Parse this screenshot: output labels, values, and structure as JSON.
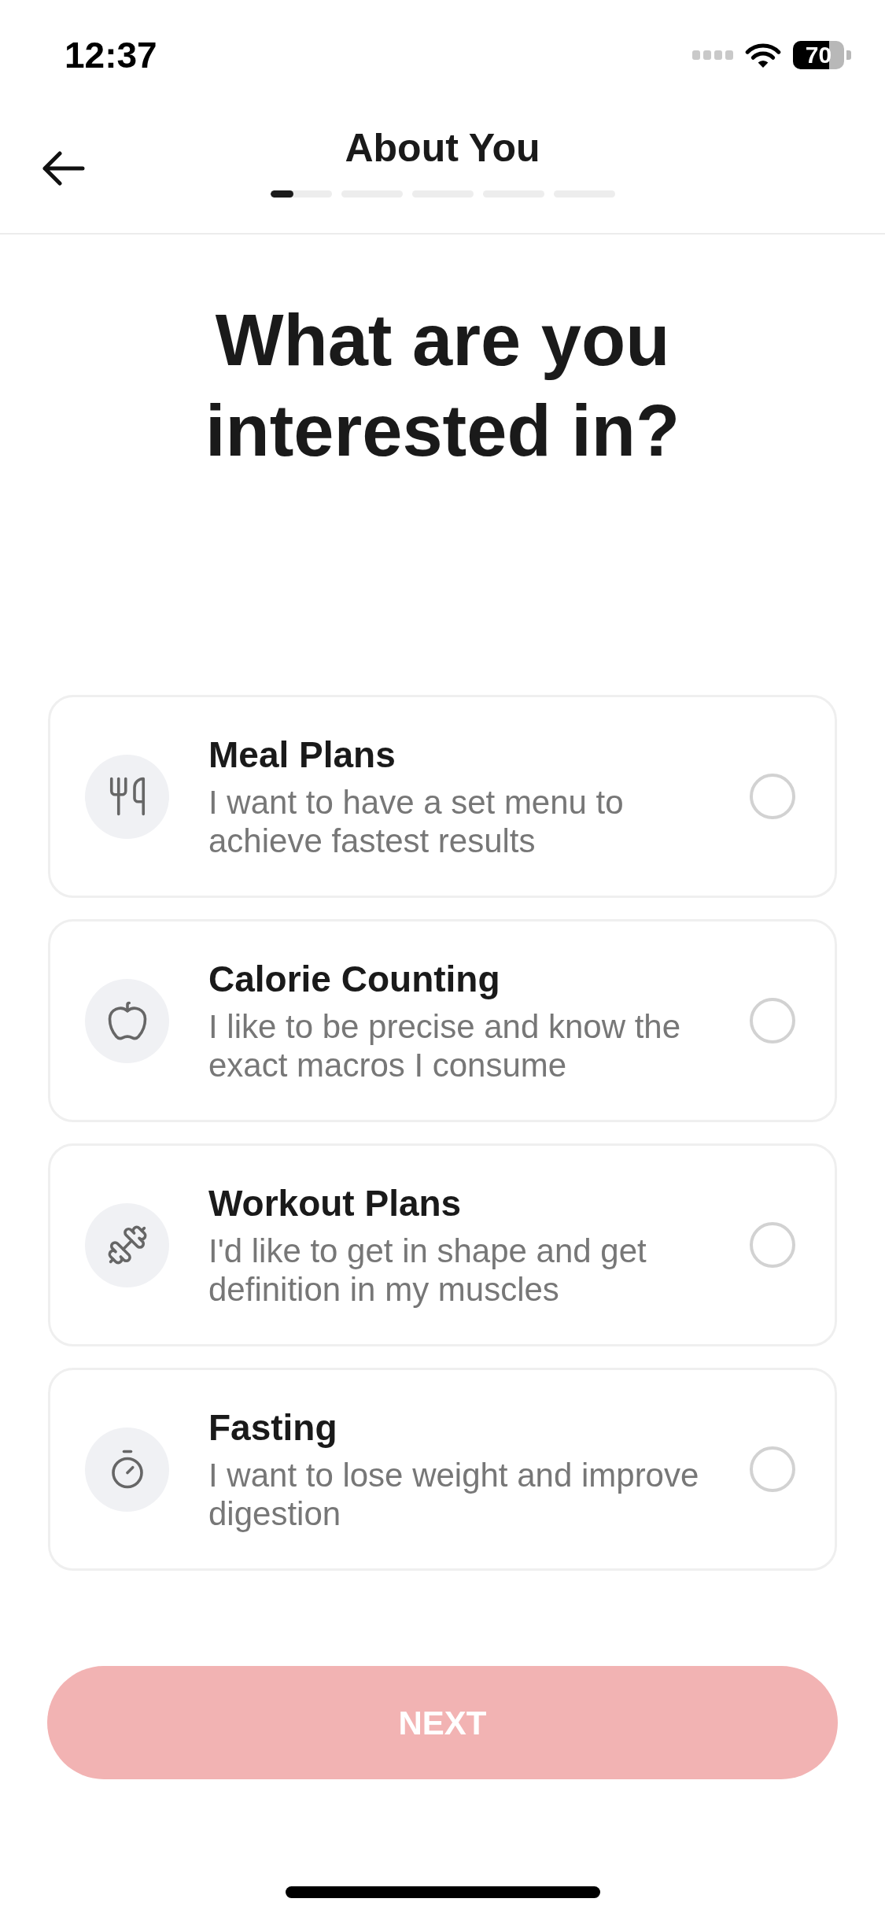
{
  "status_bar": {
    "time": "12:37",
    "battery": "70"
  },
  "header": {
    "title": "About You",
    "steps": [
      {
        "active": true
      },
      {
        "active": false
      },
      {
        "active": false
      },
      {
        "active": false
      },
      {
        "active": false
      }
    ]
  },
  "heading": "What are you interested in?",
  "options": [
    {
      "title": "Meal Plans",
      "description": "I want to have a set menu to achieve fastest results",
      "selected": false
    },
    {
      "title": "Calorie Counting",
      "description": "I like to be precise and know the exact macros I consume",
      "selected": false
    },
    {
      "title": "Workout Plans",
      "description": "I'd like to get in shape and get definition in my muscles",
      "selected": false
    },
    {
      "title": "Fasting",
      "description": "I want to lose weight and improve digestion",
      "selected": false
    }
  ],
  "next_button": {
    "label": "NEXT",
    "disabled": true
  }
}
